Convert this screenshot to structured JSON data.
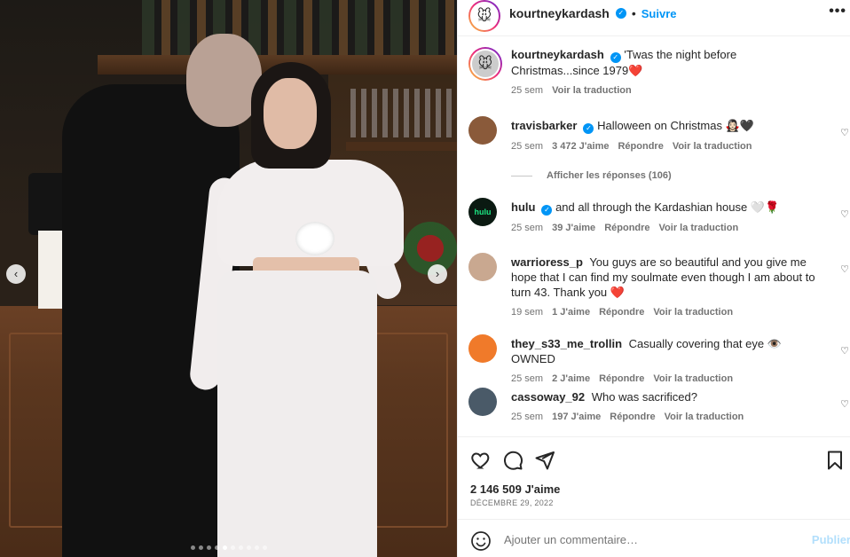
{
  "header": {
    "username": "kourtneykardash",
    "separator": "•",
    "follow_label": "Suivre",
    "more_label": "•••"
  },
  "caption": {
    "username": "kourtneykardash",
    "text": "'Twas the night before Christmas...since 1979",
    "emoji": "❤️",
    "time": "25 sem",
    "translate_label": "Voir la traduction"
  },
  "comments": [
    {
      "username": "travisbarker",
      "verified": true,
      "text": "Halloween on Christmas 🧛🏻‍♀️🖤",
      "time": "25 sem",
      "likes": "3 472 J'aime",
      "reply": "Répondre",
      "translate": "Voir la traduction"
    },
    {
      "username": "hulu",
      "verified": true,
      "text": "and all through the Kardashian house 🤍🌹",
      "time": "25 sem",
      "likes": "39 J'aime",
      "reply": "Répondre",
      "translate": "Voir la traduction"
    },
    {
      "username": "warrioress_p",
      "verified": false,
      "text": "You guys are so beautiful and you give me hope that I can find my soulmate even though I am about to turn 43. Thank you ❤️",
      "time": "19 sem",
      "likes": "1 J'aime",
      "reply": "Répondre",
      "translate": "Voir la traduction"
    },
    {
      "username": "they_s33_me_trollin",
      "verified": false,
      "text": "Casually covering that eye 👁️ OWNED",
      "time": "25 sem",
      "likes": "2 J'aime",
      "reply": "Répondre",
      "translate": "Voir la traduction"
    },
    {
      "username": "cassoway_92",
      "verified": false,
      "text": "Who was sacrificed?",
      "time": "25 sem",
      "likes": "197 J'aime",
      "reply": "Répondre",
      "translate": "Voir la traduction"
    }
  ],
  "show_replies_label": "Afficher les réponses (106)",
  "hulu_avatar_text": "hulu",
  "likes_total": "2 146 509 J'aime",
  "post_date": "DÉCEMBRE 29, 2022",
  "comment_input": {
    "placeholder": "Ajouter un commentaire…"
  },
  "post_label": "Publier",
  "carousel": {
    "prev": "‹",
    "next": "›",
    "total": 10,
    "active": 5
  },
  "colors": {
    "accent": "#0095f6",
    "heart": "#ed4956",
    "post_disabled": "#b2dffc"
  }
}
